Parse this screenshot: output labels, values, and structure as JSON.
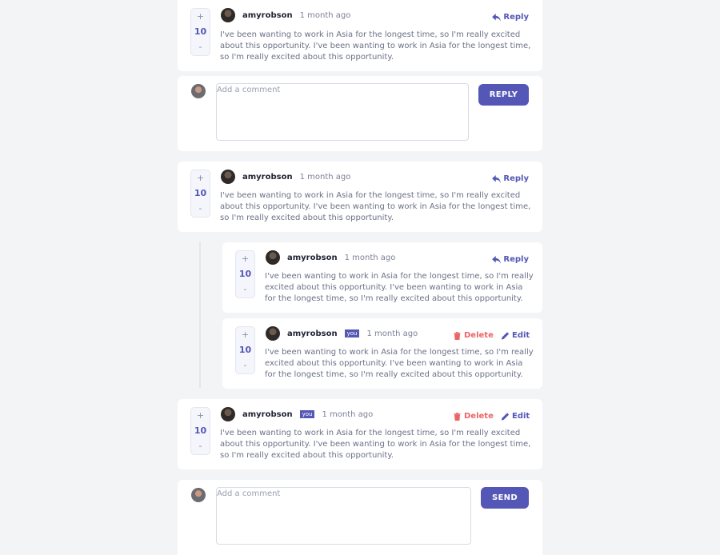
{
  "accent_color": "#5457b6",
  "delete_color": "#ed6468",
  "comments": [
    {
      "score": "10",
      "username": "amyrobson",
      "time": "1 month ago",
      "text": "I've been wanting to work in Asia for the longest time, so I'm really excited about this opportunity. I've been wanting to work in Asia for the longest time, so I'm really excited about this opportunity.",
      "action": "Reply"
    },
    {
      "score": "10",
      "username": "amyrobson",
      "time": "1 month ago",
      "text": "I've been wanting to work in Asia for the longest time, so I'm really excited about this opportunity. I've been wanting to work in Asia for the longest time, so I'm really excited about this opportunity.",
      "action": "Reply"
    },
    {
      "score": "10",
      "username": "amyrobson",
      "time": "1 month ago",
      "text": "I've been wanting to work in Asia for the longest time, so I'm really excited about this opportunity. I've been wanting to work in Asia for the longest time, so I'm really excited about this opportunity.",
      "action": "Reply"
    },
    {
      "score": "10",
      "username": "amyrobson",
      "badge": "you",
      "time": "1 month ago",
      "text": "I've been wanting to work in Asia for the longest time, so I'm really excited about this opportunity. I've been wanting to work in Asia for the longest time, so I'm really excited about this opportunity.",
      "delete_label": "Delete",
      "edit_label": "Edit"
    },
    {
      "score": "10",
      "username": "amyrobson",
      "badge": "you",
      "time": "1 month ago",
      "text": "I've been wanting to work in Asia for the longest time, so I'm really excited about this opportunity. I've been wanting to work in Asia for the longest time, so I'm really excited about this opportunity.",
      "delete_label": "Delete",
      "edit_label": "Edit"
    }
  ],
  "vote": {
    "plus": "+",
    "minus": "-"
  },
  "reply_form": {
    "placeholder": "Add a comment",
    "button": "REPLY"
  },
  "new_comment_form": {
    "placeholder": "Add a comment",
    "button": "SEND"
  },
  "icons": {
    "reply": "reply-arrow-icon",
    "delete": "trash-icon",
    "edit": "pencil-icon"
  }
}
